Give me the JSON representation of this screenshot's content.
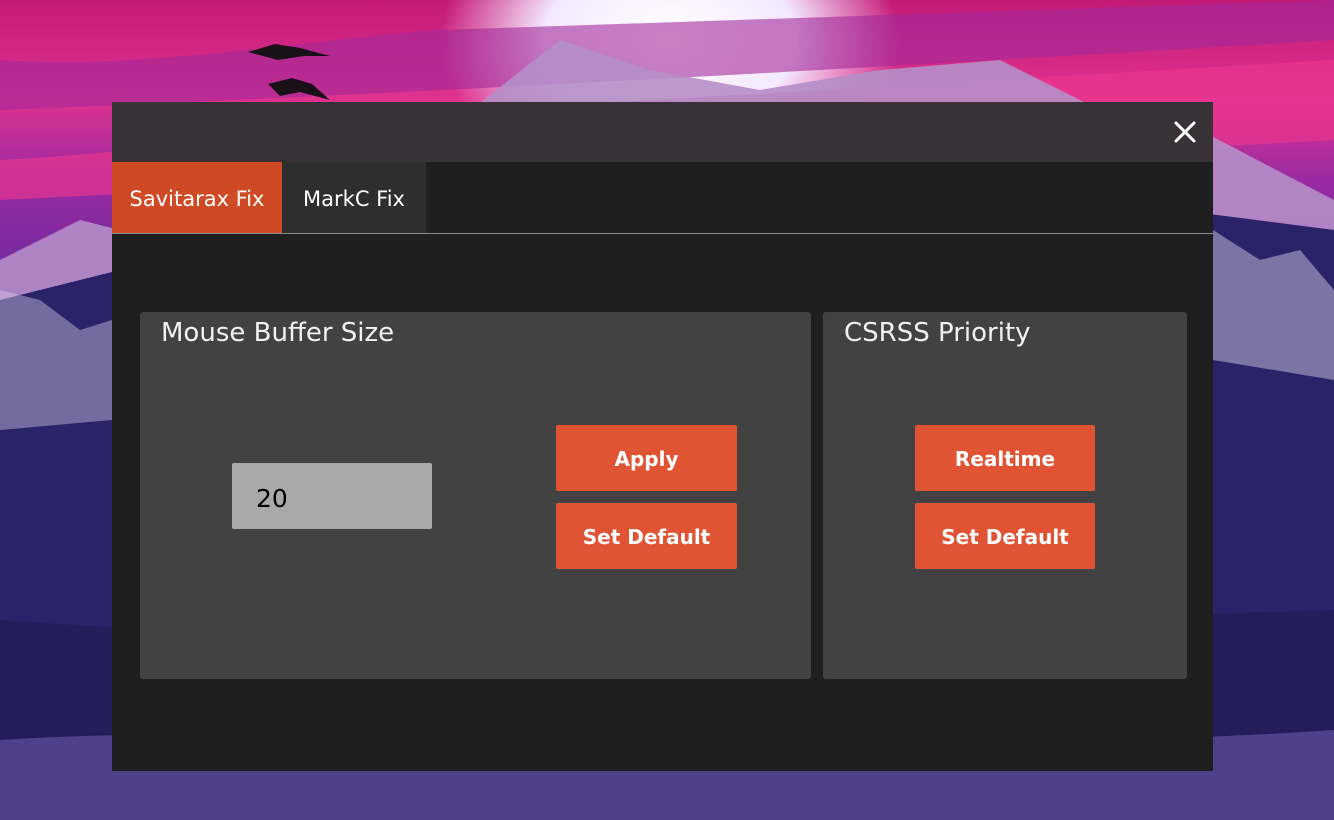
{
  "window": {
    "close_icon": "close-icon"
  },
  "tabs": [
    {
      "label": "Savitarax Fix",
      "active": true
    },
    {
      "label": "MarkC Fix",
      "active": false
    }
  ],
  "mouse_buffer": {
    "title": "Mouse Buffer Size",
    "value": "20",
    "apply_label": "Apply",
    "default_label": "Set Default"
  },
  "csrss": {
    "title": "CSRSS Priority",
    "realtime_label": "Realtime",
    "default_label": "Set Default"
  },
  "colors": {
    "accent_tab": "#cf4a24",
    "button": "#e05434",
    "window_bg": "#1f1f1f",
    "panel_bg": "#424242"
  }
}
